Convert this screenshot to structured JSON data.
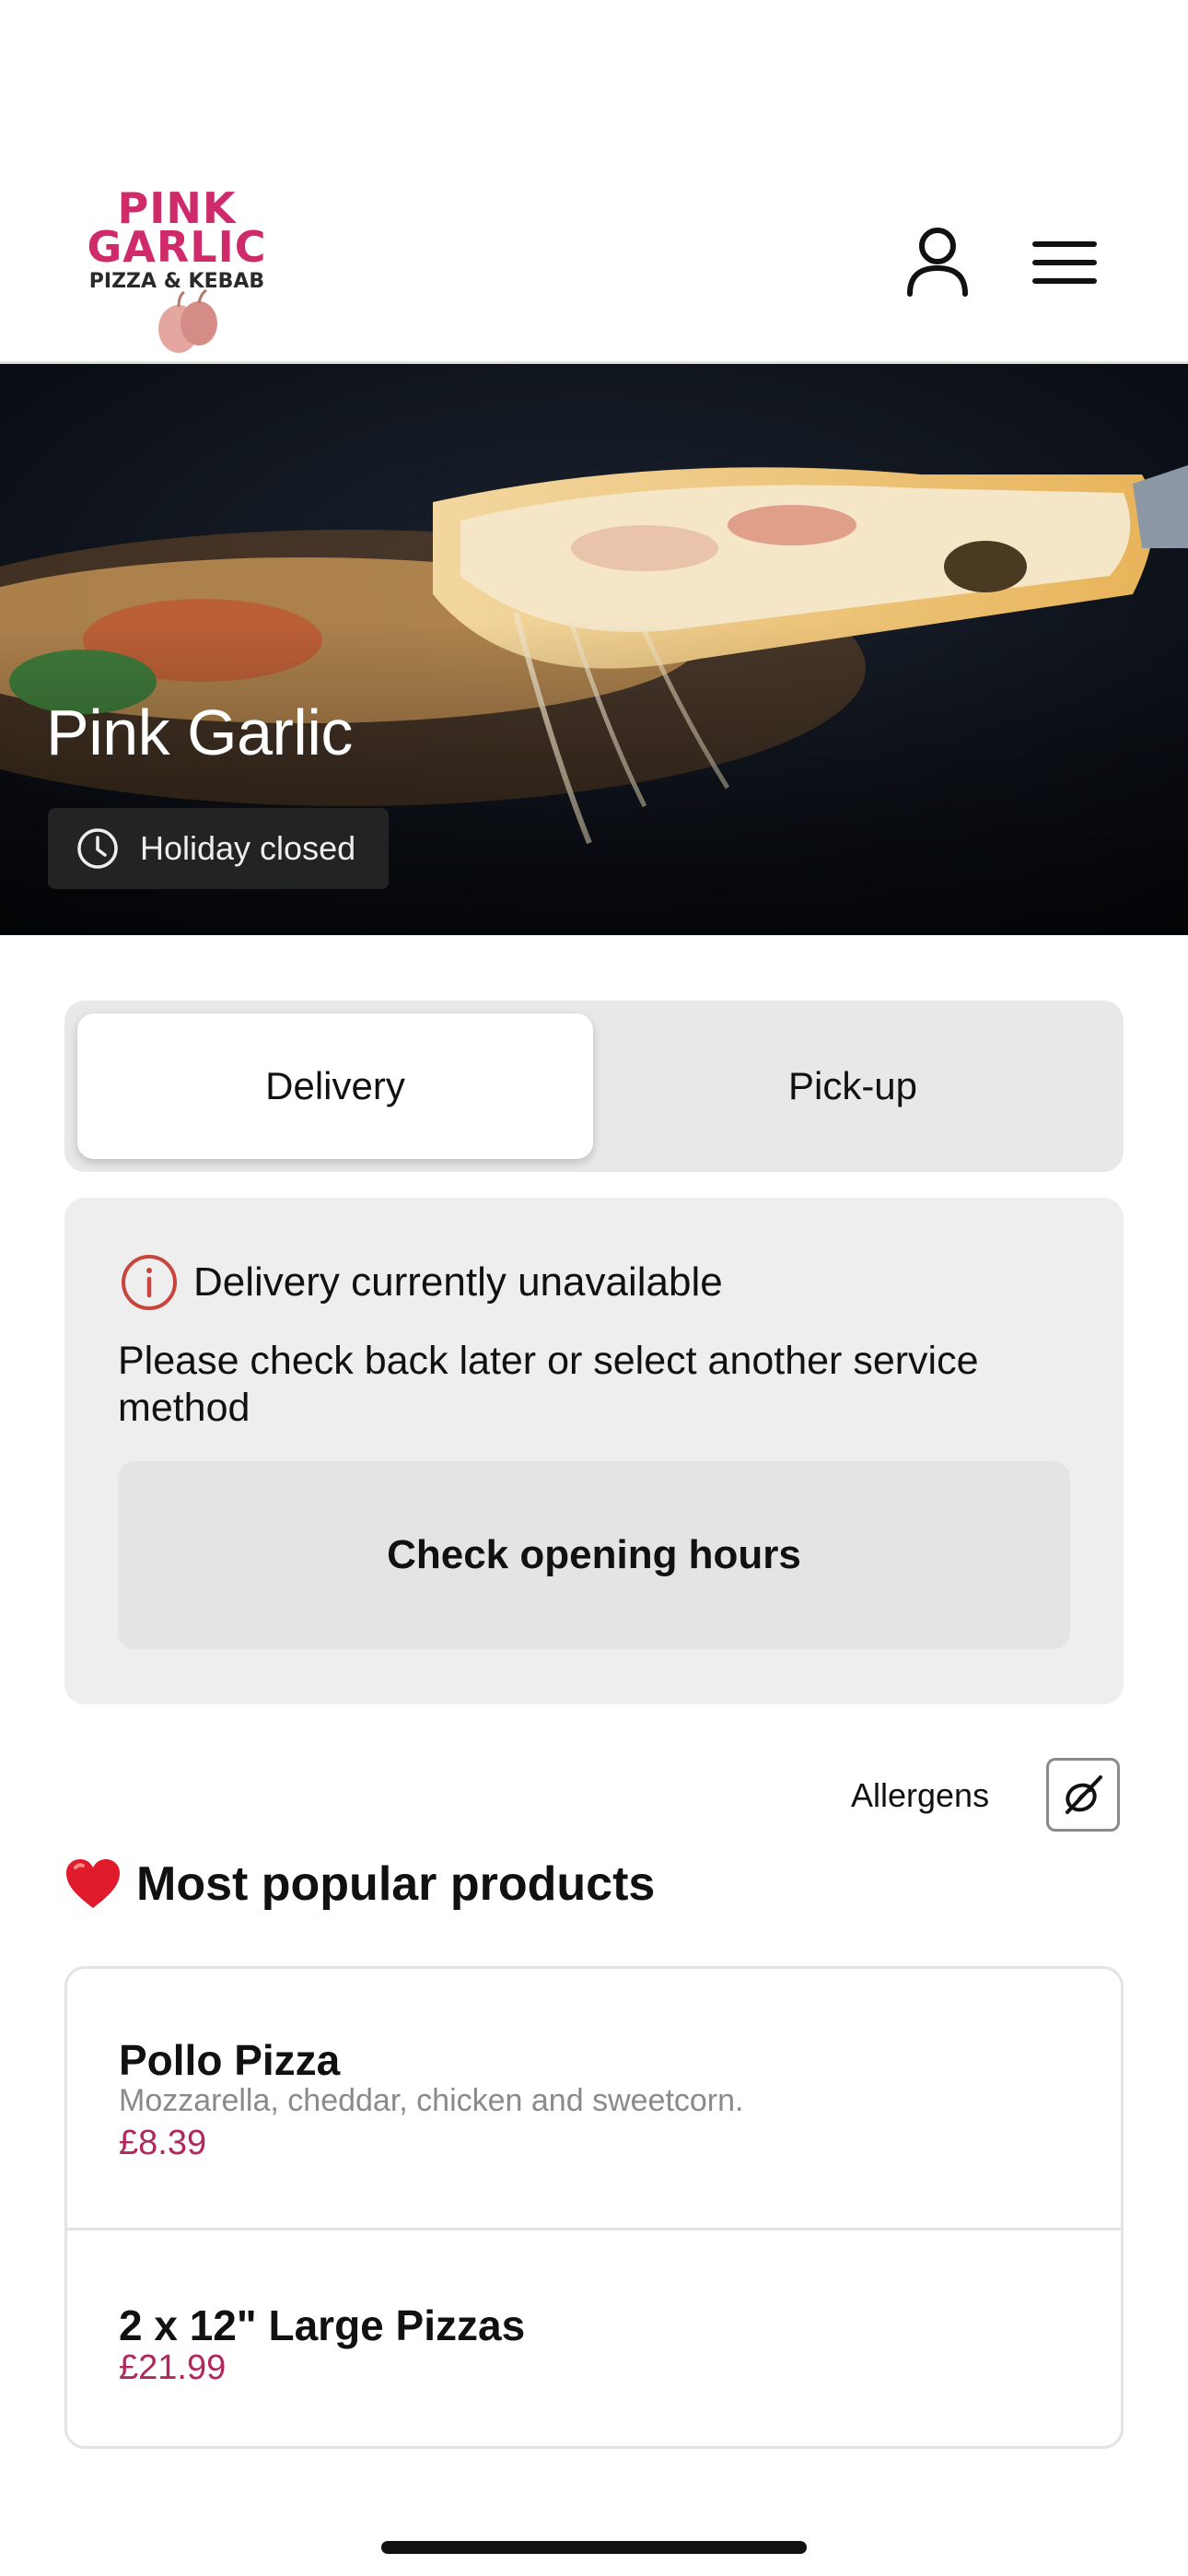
{
  "header": {
    "logo": {
      "line1": "PINK",
      "line2": "GARLIC",
      "line3": "PIZZA & KEBAB",
      "brand_color": "#cf2a6a"
    },
    "account_icon": "user-icon",
    "menu_icon": "hamburger-menu-icon"
  },
  "hero": {
    "title": "Pink Garlic",
    "status": "Holiday closed",
    "status_icon": "clock-icon"
  },
  "service_tabs": {
    "items": [
      {
        "label": "Delivery",
        "active": true
      },
      {
        "label": "Pick-up",
        "active": false
      }
    ]
  },
  "notice": {
    "icon": "info-circle-icon",
    "icon_color": "#c8443c",
    "title": "Delivery currently unavailable",
    "body": "Please check back later or select another service method",
    "button_label": "Check opening hours"
  },
  "allergens": {
    "label": "Allergens",
    "icon": "allergen-icon"
  },
  "popular": {
    "icon": "heart-icon",
    "title": "Most popular products",
    "items": [
      {
        "name": "Pollo Pizza",
        "description": "Mozzarella, cheddar, chicken and sweetcorn.",
        "price": "£8.39"
      },
      {
        "name": "2 x 12\" Large Pizzas",
        "description": "",
        "price": "£21.99"
      }
    ]
  },
  "colors": {
    "price": "#b0285e",
    "heart": "#e01b2b"
  }
}
